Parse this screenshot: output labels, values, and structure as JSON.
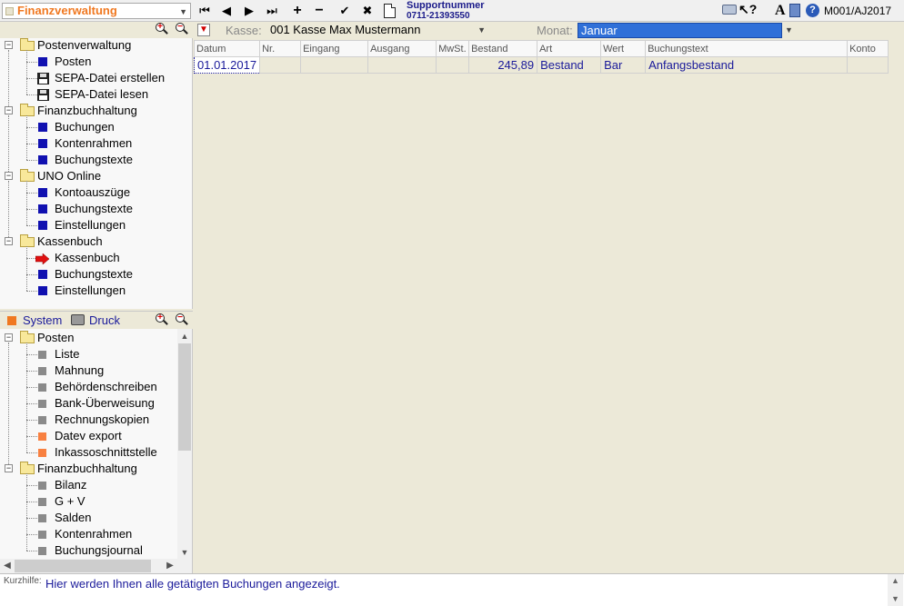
{
  "toolbar": {
    "module_selector": "Finanzverwaltung",
    "nav": {
      "first": "⏮",
      "prev": "◀",
      "next": "▶",
      "last": "⏭"
    },
    "actions": {
      "add": "+",
      "remove": "−",
      "confirm": "✔",
      "cancel": "✖"
    },
    "support_label": "Supportnummer",
    "support_number": "0711-21393550",
    "mandant_code": "M001/AJ2017"
  },
  "tree_top": {
    "groups": [
      {
        "label": "Postenverwaltung",
        "items": [
          {
            "label": "Posten",
            "icon": "blue-square"
          },
          {
            "label": "SEPA-Datei erstellen",
            "icon": "floppy-disk"
          },
          {
            "label": "SEPA-Datei lesen",
            "icon": "floppy-disk"
          }
        ]
      },
      {
        "label": "Finanzbuchhaltung",
        "items": [
          {
            "label": "Buchungen",
            "icon": "blue-square"
          },
          {
            "label": "Kontenrahmen",
            "icon": "blue-square"
          },
          {
            "label": "Buchungstexte",
            "icon": "blue-square"
          }
        ]
      },
      {
        "label": "UNO Online",
        "items": [
          {
            "label": "Kontoauszüge",
            "icon": "blue-square"
          },
          {
            "label": "Buchungstexte",
            "icon": "blue-square"
          },
          {
            "label": "Einstellungen",
            "icon": "blue-square"
          }
        ]
      },
      {
        "label": "Kassenbuch",
        "items": [
          {
            "label": "Kassenbuch",
            "icon": "red-arrow"
          },
          {
            "label": "Buchungstexte",
            "icon": "blue-square"
          },
          {
            "label": "Einstellungen",
            "icon": "blue-square"
          }
        ]
      }
    ]
  },
  "tree_bottom": {
    "system_label": "System",
    "druck_label": "Druck",
    "groups": [
      {
        "label": "Posten",
        "items": [
          {
            "label": "Liste",
            "icon": "grey-square"
          },
          {
            "label": "Mahnung",
            "icon": "grey-square"
          },
          {
            "label": "Behördenschreiben",
            "icon": "grey-square"
          },
          {
            "label": "Bank-Überweisung",
            "icon": "grey-square"
          },
          {
            "label": "Rechnungskopien",
            "icon": "grey-square"
          },
          {
            "label": "Datev export",
            "icon": "orange-square"
          },
          {
            "label": "Inkassoschnittstelle",
            "icon": "orange-square"
          }
        ]
      },
      {
        "label": "Finanzbuchhaltung",
        "items": [
          {
            "label": "Bilanz",
            "icon": "grey-square"
          },
          {
            "label": "G + V",
            "icon": "grey-square"
          },
          {
            "label": "Salden",
            "icon": "grey-square"
          },
          {
            "label": "Kontenrahmen",
            "icon": "grey-square"
          },
          {
            "label": "Buchungsjournal",
            "icon": "grey-square"
          }
        ]
      }
    ]
  },
  "filter": {
    "kasse_label": "Kasse:",
    "kasse_value": "001 Kasse Max Mustermann",
    "monat_label": "Monat:",
    "monat_value": "Januar"
  },
  "grid": {
    "columns": [
      "Datum",
      "Nr.",
      "Eingang",
      "Ausgang",
      "MwSt.",
      "Bestand",
      "Art",
      "Wert",
      "Buchungstext",
      "Konto"
    ],
    "rows": [
      [
        "01.01.2017",
        "",
        "",
        "",
        "",
        "245,89",
        "Bestand",
        "Bar",
        "Anfangsbestand",
        ""
      ]
    ]
  },
  "statusbar": {
    "kurzhilfe_label": "Kurzhilfe:",
    "kurzhilfe_text": "Hier werden Ihnen alle getätigten Buchungen angezeigt."
  },
  "colors": {
    "accent_orange": "#f07820",
    "link_blue": "#1a1a9a",
    "selection_blue": "#3070d8",
    "background": "#ece9d8"
  }
}
